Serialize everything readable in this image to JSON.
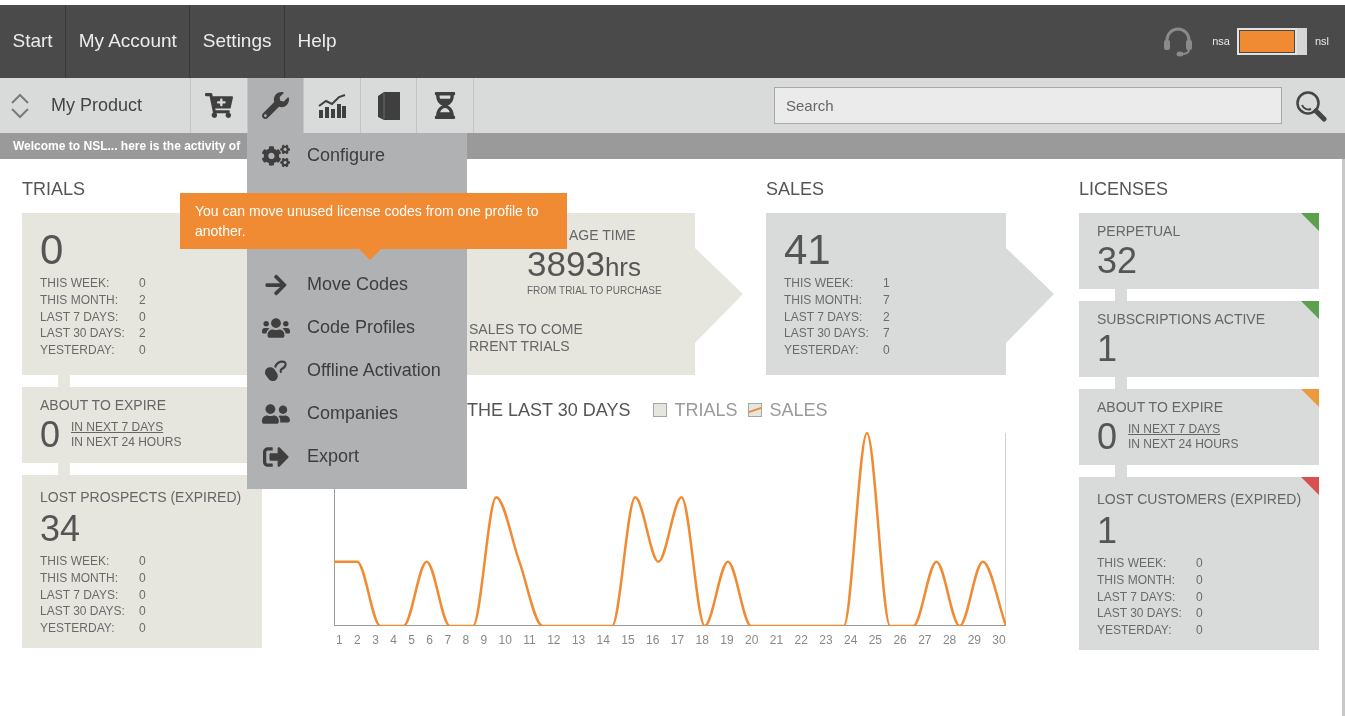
{
  "top_nav": {
    "items": [
      {
        "label": "Start"
      },
      {
        "label": "My Account"
      },
      {
        "label": "Settings"
      },
      {
        "label": "Help"
      }
    ],
    "toggle": {
      "left_label": "nsa",
      "on": true,
      "right_label": "nsl"
    }
  },
  "toolbar": {
    "product": "My Product",
    "buttons": [
      {
        "kind": "cart",
        "selected": false
      },
      {
        "kind": "wrench",
        "selected": true
      },
      {
        "kind": "chart",
        "selected": false
      },
      {
        "kind": "book",
        "selected": false
      },
      {
        "kind": "hourglass",
        "selected": false
      }
    ],
    "search": {
      "placeholder": "Search"
    }
  },
  "welcome_message": "Welcome to NSL... here is the activity of",
  "trials": {
    "title": "TRIALS",
    "cards": [
      {
        "kind": "stats",
        "number": "0",
        "stats": [
          {
            "label": "THIS WEEK:",
            "value": "0"
          },
          {
            "label": "THIS MONTH:",
            "value": "2"
          },
          {
            "label": "LAST 7 DAYS:",
            "value": "0"
          },
          {
            "label": "LAST 30 DAYS:",
            "value": "2"
          },
          {
            "label": "YESTERDAY:",
            "value": "0"
          }
        ]
      },
      {
        "kind": "expire",
        "title": "ABOUT TO EXPIRE",
        "number": "0",
        "options": [
          {
            "label": "IN NEXT 7 DAYS",
            "selected": true
          },
          {
            "label": "IN NEXT 24 HOURS",
            "selected": false
          }
        ]
      },
      {
        "kind": "stats",
        "title": "LOST PROSPECTS (EXPIRED)",
        "number": "34",
        "stats": [
          {
            "label": "THIS WEEK:",
            "value": "0"
          },
          {
            "label": "THIS MONTH:",
            "value": "0"
          },
          {
            "label": "LAST 7 DAYS:",
            "value": "0"
          },
          {
            "label": "LAST 30 DAYS:",
            "value": "0"
          },
          {
            "label": "YESTERDAY:",
            "value": "0"
          }
        ]
      }
    ]
  },
  "conversion": {
    "time_label": "AGE TIME",
    "time_value": "3893",
    "time_unit": "hrs",
    "time_caption": "FROM TRIAL TO PURCHASE",
    "forecast_lines": [
      "SALES TO COME",
      "RRENT TRIALS"
    ]
  },
  "sales": {
    "title": "SALES",
    "card": {
      "kind": "stats",
      "number": "41",
      "stats": [
        {
          "label": "THIS WEEK:",
          "value": "1"
        },
        {
          "label": "THIS MONTH:",
          "value": "7"
        },
        {
          "label": "LAST 7 DAYS:",
          "value": "2"
        },
        {
          "label": "LAST 30 DAYS:",
          "value": "7"
        },
        {
          "label": "YESTERDAY:",
          "value": "0"
        }
      ]
    }
  },
  "licenses": {
    "title": "LICENSES",
    "cards": [
      {
        "kind": "count",
        "title": "PERPETUAL",
        "number": "32",
        "color": "#5c9f4c"
      },
      {
        "kind": "count",
        "title": "SUBSCRIPTIONS ACTIVE",
        "number": "1",
        "color": "#5c9f4c"
      },
      {
        "kind": "expire",
        "title": "ABOUT TO EXPIRE",
        "number": "0",
        "color": "#ee9a3c",
        "options": [
          {
            "label": "IN NEXT 7 DAYS",
            "selected": true
          },
          {
            "label": "IN NEXT 24 HOURS",
            "selected": false
          }
        ]
      },
      {
        "kind": "stats",
        "title": "LOST CUSTOMERS (EXPIRED)",
        "number": "1",
        "color": "#d65050",
        "stats": [
          {
            "label": "THIS WEEK:",
            "value": "0"
          },
          {
            "label": "THIS MONTH:",
            "value": "0"
          },
          {
            "label": "LAST 7 DAYS:",
            "value": "0"
          },
          {
            "label": "LAST 30 DAYS:",
            "value": "0"
          },
          {
            "label": "YESTERDAY:",
            "value": "0"
          }
        ]
      }
    ]
  },
  "activity_chart": {
    "title": "THE LAST 30 DAYS",
    "legend": [
      {
        "label": "TRIALS",
        "checked": false
      },
      {
        "label": "SALES",
        "checked": true,
        "color": "#f08a33"
      }
    ],
    "day_labels": [
      "1",
      "2",
      "3",
      "4",
      "5",
      "6",
      "7",
      "8",
      "9",
      "10",
      "11",
      "12",
      "13",
      "14",
      "15",
      "16",
      "17",
      "18",
      "19",
      "20",
      "21",
      "22",
      "23",
      "24",
      "25",
      "26",
      "27",
      "28",
      "29",
      "30"
    ]
  },
  "tools_menu": {
    "items": [
      {
        "kind": "gears",
        "label": "Configure"
      },
      {
        "kind": "arrow",
        "label": "Move Codes"
      },
      {
        "kind": "group",
        "label": "Code Profiles"
      },
      {
        "kind": "mouse",
        "label": "Offline Activation"
      },
      {
        "kind": "people",
        "label": "Companies"
      },
      {
        "kind": "export",
        "label": "Export"
      }
    ]
  },
  "tooltip": "You can move unused license codes from one profile to another."
}
